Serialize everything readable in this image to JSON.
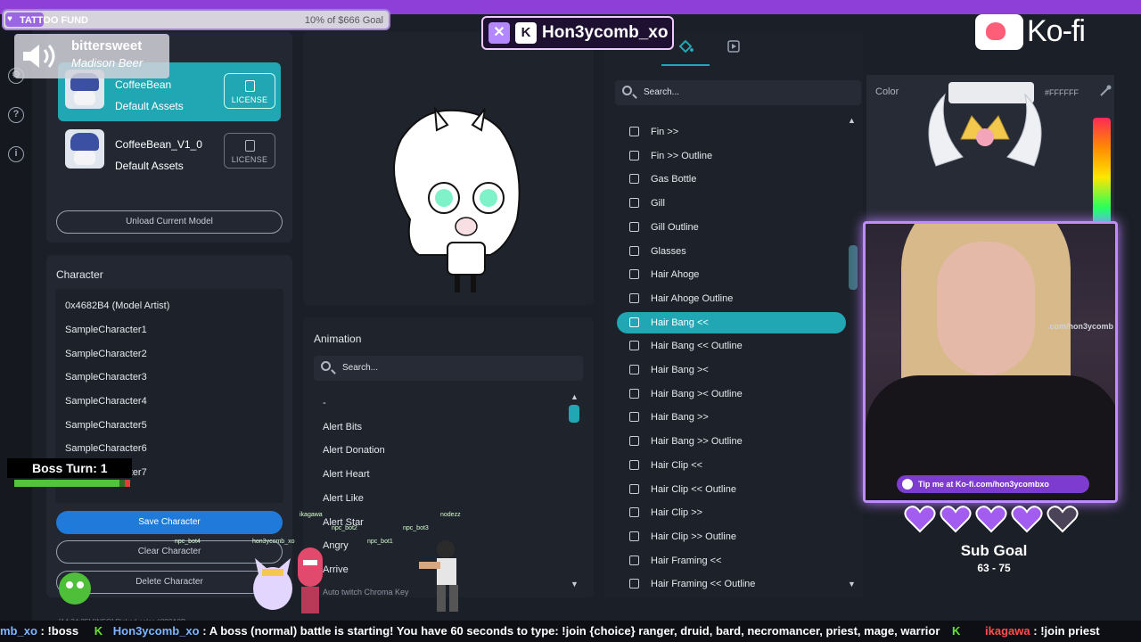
{
  "overlay": {
    "fund": {
      "title": "TATTOO FUND",
      "goal_text": "10% of $666 Goal",
      "progress": 0.1
    },
    "music": {
      "song": "bittersweet",
      "artist": "Madison Beer"
    },
    "channel_name": "Hon3ycomb_xo",
    "kofi_logo": "Ko-fi",
    "kofi_tip": "Tip me at Ko-fi.com/hon3ycombxo",
    "sub_goal": {
      "title": "Sub Goal",
      "count": "63 - 75",
      "hearts_filled": 4,
      "hearts_total": 5
    },
    "boss": {
      "label": "Boss Turn: 1",
      "hp_fraction": 0.95
    },
    "sprites": [
      {
        "name": "ikagawa"
      },
      {
        "name": "nodezz"
      },
      {
        "name": "npc_bot4"
      },
      {
        "name": "npc_bot2"
      },
      {
        "name": "npc_bot1"
      },
      {
        "name": "npc_bot3"
      },
      {
        "name": "hon3ycomb_xo"
      }
    ],
    "log_line": "[14:34:25] [INFO] Picked color #898A8B",
    "webcam_watermark": ".com/hon3ycomb"
  },
  "models": [
    {
      "name": "CoffeeBean",
      "sub": "Default Assets",
      "license": "LICENSE",
      "active": true
    },
    {
      "name": "CoffeeBean_V1_0",
      "sub": "Default Assets",
      "license": "LICENSE",
      "active": false
    }
  ],
  "buttons": {
    "unload": "Unload Current Model",
    "save": "Save Character",
    "clear": "Clear Character",
    "delete": "Delete Character"
  },
  "character": {
    "title": "Character",
    "items": [
      "0x4682B4 (Model Artist)",
      "SampleCharacter1",
      "SampleCharacter2",
      "SampleCharacter3",
      "SampleCharacter4",
      "SampleCharacter5",
      "SampleCharacter6",
      "SampleCharacter7"
    ]
  },
  "animation": {
    "title": "Animation",
    "search_placeholder": "Search...",
    "items": [
      "-",
      "Alert Bits",
      "Alert Donation",
      "Alert Heart",
      "Alert Like",
      "Alert Star",
      "Angry",
      "Arrive",
      "Auto twitch Chroma Key"
    ]
  },
  "parts": {
    "search_placeholder": "Search...",
    "selected_index": 8,
    "items": [
      "Fin >>",
      "Fin >> Outline",
      "Gas Bottle",
      "Gill",
      "Gill Outline",
      "Glasses",
      "Hair Ahoge",
      "Hair Ahoge Outline",
      "Hair Bang <<",
      "Hair Bang << Outline",
      "Hair Bang ><",
      "Hair Bang >< Outline",
      "Hair Bang >>",
      "Hair Bang >> Outline",
      "Hair Clip <<",
      "Hair Clip << Outline",
      "Hair Clip >>",
      "Hair Clip >> Outline",
      "Hair Framing <<",
      "Hair Framing << Outline"
    ]
  },
  "color_picker": {
    "label": "Color",
    "hex": "#FFFFFF",
    "value": "#e9ebef"
  },
  "chat": {
    "prefix": "mb_xo",
    "prefix_msg": ": !boss",
    "user1": "Hon3ycomb_xo",
    "msg1": ": A boss (normal) battle is starting! You have 60 seconds to type: !join {choice} ranger, druid, bard, necromancer, priest, mage, warrior",
    "user2": "ikagawa",
    "msg2": ": !join priest"
  },
  "colors": {
    "accent": "#21a7b3",
    "primary": "#1f7ad9",
    "purple": "#8d3fd8"
  }
}
